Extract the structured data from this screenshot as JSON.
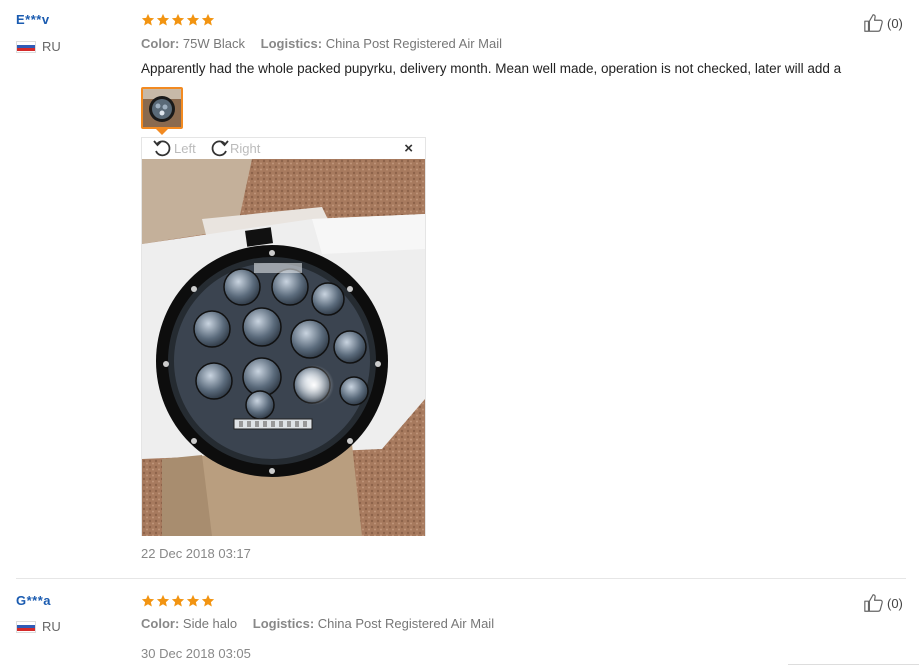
{
  "reviews": [
    {
      "user": "E***v",
      "country": "RU",
      "rating": 5,
      "color_label": "Color:",
      "color_value": "75W Black",
      "logistics_label": "Logistics:",
      "logistics_value": "China Post Registered Air Mail",
      "text": "Apparently had the whole packed pupyrku, delivery month. Mean well made, operation is not checked, later will add a",
      "helpful_count": "(0)",
      "date": "22 Dec 2018 03:17",
      "viewer": {
        "rotate_left": "Left",
        "rotate_right": "Right",
        "close": "×"
      }
    },
    {
      "user": "G***a",
      "country": "RU",
      "rating": 5,
      "color_label": "Color:",
      "color_value": "Side halo",
      "logistics_label": "Logistics:",
      "logistics_value": "China Post Registered Air Mail",
      "helpful_count": "(0)",
      "date": "30 Dec 2018 03:05"
    }
  ],
  "colors": {
    "star": "#f29411",
    "user": "#1a5bb0",
    "thumb_border": "#f28a21"
  },
  "icons": {
    "helpful": "thumbs-up-icon",
    "rotate_left": "rotate-left-icon",
    "rotate_right": "rotate-right-icon",
    "close": "close-icon",
    "flag": "russia-flag-icon"
  }
}
